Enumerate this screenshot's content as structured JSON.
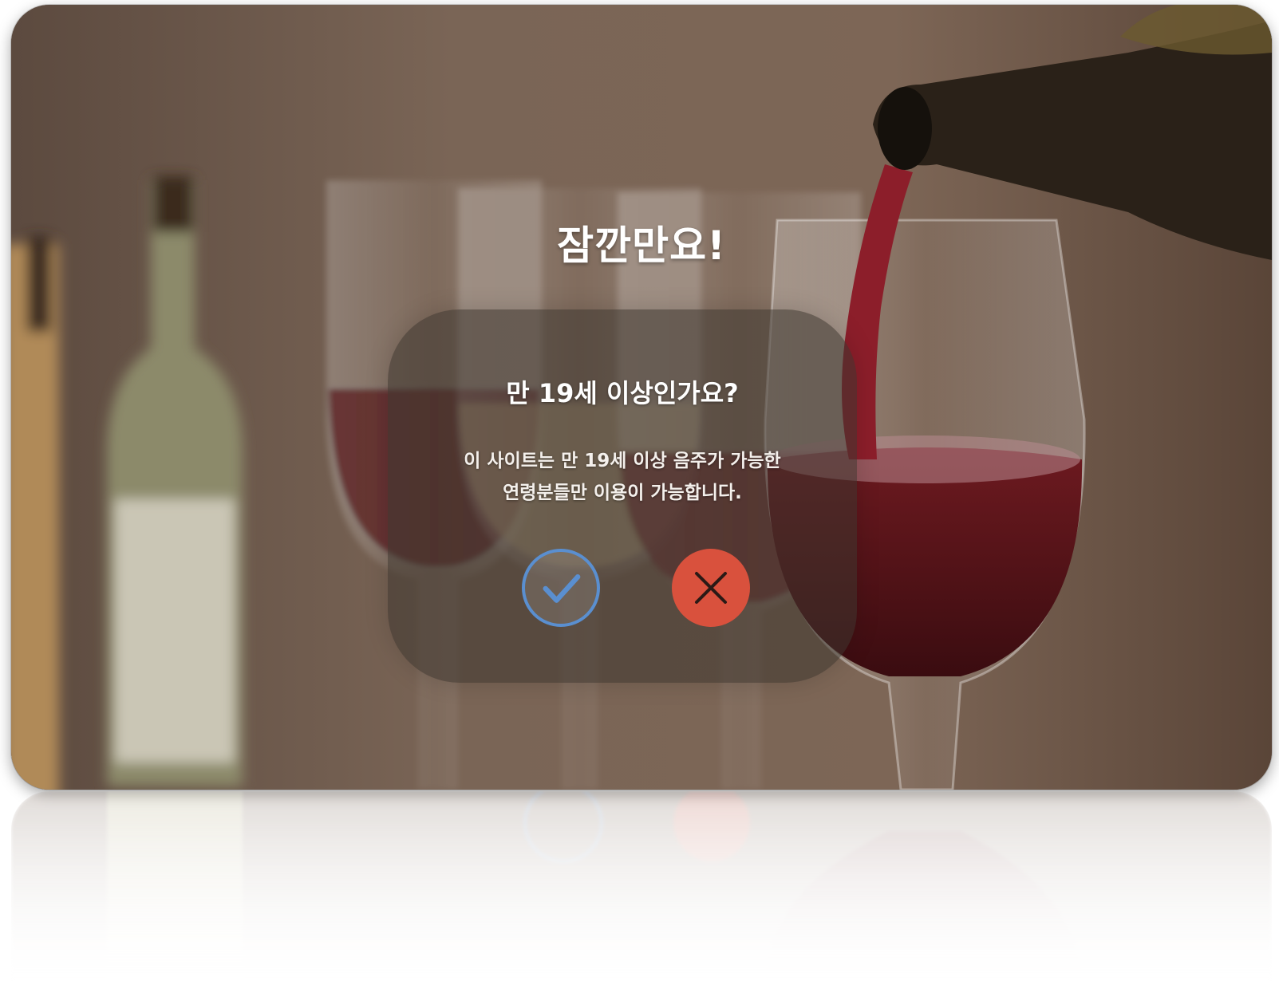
{
  "modal": {
    "title": "잠깐만요!",
    "question": "만 19세 이상인가요?",
    "description_line1": "이 사이트는 만 19세 이상 음주가 가능한",
    "description_line2": "연령분들만 이용이 가능합니다.",
    "confirm_icon": "check-circle-icon",
    "cancel_icon": "close-circle-icon"
  },
  "colors": {
    "confirm_accent": "#5a8fd0",
    "cancel_accent": "#d9513d"
  }
}
